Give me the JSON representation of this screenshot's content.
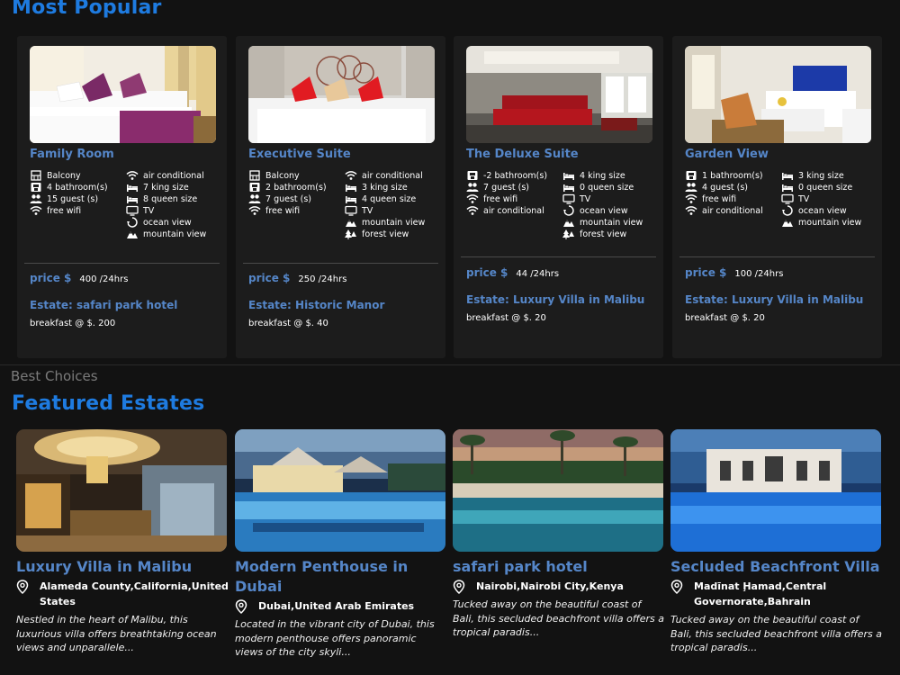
{
  "popular": {
    "title": "Most Popular",
    "rooms": [
      {
        "name": "Family Room",
        "left": [
          {
            "icon": "balcony-icon",
            "text": "Balcony"
          },
          {
            "icon": "bathroom-icon",
            "text": "4 bathroom(s)"
          },
          {
            "icon": "guests-icon",
            "text": "15 guest (s)"
          },
          {
            "icon": "wifi-icon",
            "text": "free wifi"
          }
        ],
        "right": [
          {
            "icon": "wifi-icon",
            "text": "air conditional"
          },
          {
            "icon": "bed-icon",
            "text": "7 king size"
          },
          {
            "icon": "bed-icon",
            "text": "8 queen size"
          },
          {
            "icon": "tv-icon",
            "text": "TV"
          },
          {
            "icon": "ocean-view-icon",
            "text": "ocean view"
          },
          {
            "icon": "mountain-view-icon",
            "text": "mountain view"
          }
        ],
        "price_label": "price $",
        "price": "400 /24hrs",
        "estate": "Estate: safari park hotel",
        "breakfast": "breakfast @ $. 200"
      },
      {
        "name": "Executive Suite",
        "left": [
          {
            "icon": "balcony-icon",
            "text": "Balcony"
          },
          {
            "icon": "bathroom-icon",
            "text": "2 bathroom(s)"
          },
          {
            "icon": "guests-icon",
            "text": "7 guest (s)"
          },
          {
            "icon": "wifi-icon",
            "text": "free wifi"
          }
        ],
        "right": [
          {
            "icon": "wifi-icon",
            "text": "air conditional"
          },
          {
            "icon": "bed-icon",
            "text": "3 king size"
          },
          {
            "icon": "bed-icon",
            "text": "4 queen size"
          },
          {
            "icon": "tv-icon",
            "text": "TV"
          },
          {
            "icon": "mountain-view-icon",
            "text": "mountain view"
          },
          {
            "icon": "forest-view-icon",
            "text": "forest view"
          }
        ],
        "price_label": "price $",
        "price": "250 /24hrs",
        "estate": "Estate: Historic Manor",
        "breakfast": "breakfast @ $. 40"
      },
      {
        "name": "The Deluxe Suite",
        "left": [
          {
            "icon": "bathroom-icon",
            "text": "-2 bathroom(s)"
          },
          {
            "icon": "guests-icon",
            "text": "7 guest (s)"
          },
          {
            "icon": "wifi-icon",
            "text": "free wifi"
          },
          {
            "icon": "wifi-icon",
            "text": "air conditional"
          }
        ],
        "right": [
          {
            "icon": "bed-icon",
            "text": "4 king size"
          },
          {
            "icon": "bed-icon",
            "text": "0 queen size"
          },
          {
            "icon": "tv-icon",
            "text": "TV"
          },
          {
            "icon": "ocean-view-icon",
            "text": "ocean view"
          },
          {
            "icon": "mountain-view-icon",
            "text": "mountain view"
          },
          {
            "icon": "forest-view-icon",
            "text": "forest view"
          }
        ],
        "price_label": "price $",
        "price": "44 /24hrs",
        "estate": "Estate: Luxury Villa in Malibu",
        "breakfast": "breakfast @ $. 20"
      },
      {
        "name": "Garden View",
        "left": [
          {
            "icon": "bathroom-icon",
            "text": "1 bathroom(s)"
          },
          {
            "icon": "guests-icon",
            "text": "4 guest (s)"
          },
          {
            "icon": "wifi-icon",
            "text": "free wifi"
          },
          {
            "icon": "wifi-icon",
            "text": "air conditional"
          }
        ],
        "right": [
          {
            "icon": "bed-icon",
            "text": "3 king size"
          },
          {
            "icon": "bed-icon",
            "text": "0 queen size"
          },
          {
            "icon": "tv-icon",
            "text": "TV"
          },
          {
            "icon": "ocean-view-icon",
            "text": "ocean view"
          },
          {
            "icon": "mountain-view-icon",
            "text": "mountain view"
          }
        ],
        "price_label": "price $",
        "price": "100 /24hrs",
        "estate": "Estate: Luxury Villa in Malibu",
        "breakfast": "breakfast @ $. 20"
      }
    ]
  },
  "featured": {
    "eyebrow": "Best Choices",
    "title": "Featured Estates",
    "estates": [
      {
        "name": "Luxury Villa in Malibu",
        "location": "Alameda County,California,United States",
        "description": "Nestled in the heart of Malibu, this luxurious villa offers breathtaking ocean views and unparallele..."
      },
      {
        "name": "Modern Penthouse in Dubai",
        "location": "Dubai,United Arab Emirates",
        "description": "Located in the vibrant city of Dubai, this modern penthouse offers panoramic views of the city skyli..."
      },
      {
        "name": "safari park hotel",
        "location": "Nairobi,Nairobi City,Kenya",
        "description": "Tucked away on the beautiful coast of Bali, this secluded beachfront villa offers a tropical paradis..."
      },
      {
        "name": "Secluded Beachfront Villa",
        "location": "Madīnat Ḩamad,Central Governorate,Bahrain",
        "description": "Tucked away on the beautiful coast of Bali, this secluded beachfront villa offers a tropical paradis..."
      }
    ]
  },
  "colors": {
    "accent": "#1e7be0",
    "link": "#5586c8",
    "background": "#121212",
    "card": "#1c1c1c"
  }
}
